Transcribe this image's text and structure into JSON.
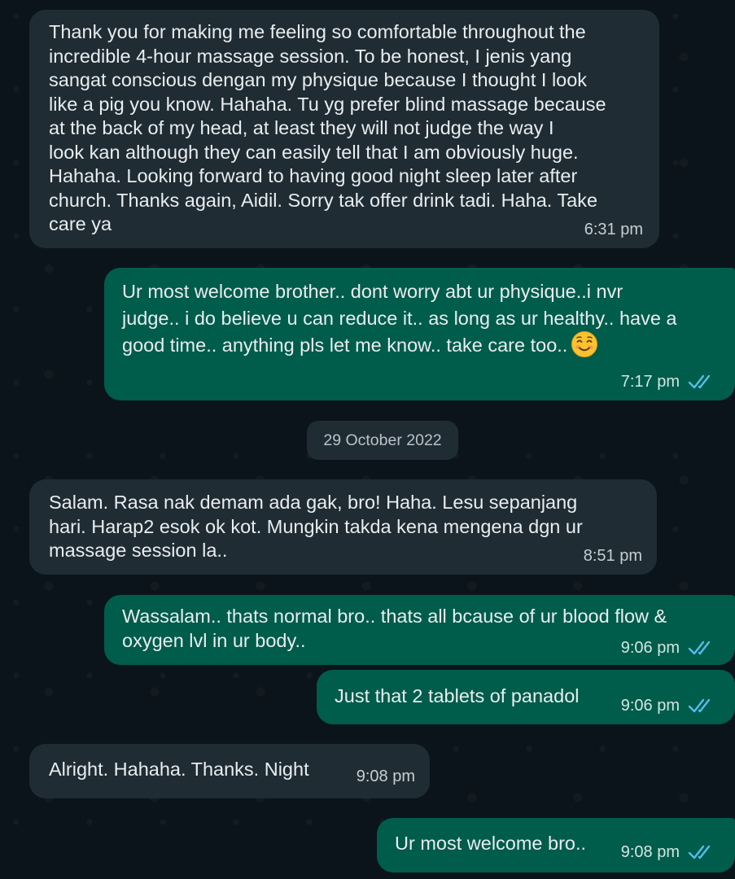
{
  "messages": [
    {
      "direction": "incoming",
      "text": "Thank you for making me feeling so comfortable throughout the\nincredible 4-hour massage session. To be honest, I jenis yang\nsangat conscious dengan my physique because I thought I look\nlike a pig you know. Hahaha. Tu yg prefer blind massage because\nat the back of my head, at least they will not judge the way I\nlook kan although they can easily tell that I am obviously huge.\nHahaha. Looking forward to having good night sleep later after\nchurch. Thanks again, Aidil. Sorry tak offer drink tadi. Haha. Take\ncare ya",
      "time": "6:31 pm"
    },
    {
      "direction": "outgoing",
      "text": "Ur most welcome brother.. dont worry abt ur physique..i nvr\njudge.. i do believe u can reduce it.. as long as ur healthy.. have a\ngood time.. anything pls let me know.. take care too..",
      "emoji": "smiling-face-emoji",
      "time": "7:17 pm",
      "status": "read"
    },
    {
      "direction": "incoming",
      "text": "Salam. Rasa nak demam ada gak, bro! Haha. Lesu sepanjang\nhari. Harap2 esok ok kot. Mungkin takda kena mengena dgn ur\nmassage session la..",
      "time": "8:51 pm"
    },
    {
      "direction": "outgoing",
      "text": "Wassalam.. thats normal bro.. thats all bcause of ur blood flow &\noxygen lvl in ur body..",
      "time": "9:06 pm",
      "status": "read"
    },
    {
      "direction": "outgoing",
      "text": "Just that 2 tablets of panadol",
      "time": "9:06 pm",
      "status": "read"
    },
    {
      "direction": "incoming",
      "text": "Alright. Hahaha. Thanks. Night",
      "time": "9:08 pm"
    },
    {
      "direction": "outgoing",
      "text": "Ur most welcome bro..",
      "time": "9:08 pm",
      "status": "read"
    }
  ],
  "date_separator": "29 October 2022",
  "colors": {
    "background": "#0b141a",
    "incoming_bubble": "#1f2c33",
    "outgoing_bubble": "#005c4b",
    "read_tick": "#53bdeb"
  },
  "icons": {
    "read_receipt": "double-check-icon"
  }
}
